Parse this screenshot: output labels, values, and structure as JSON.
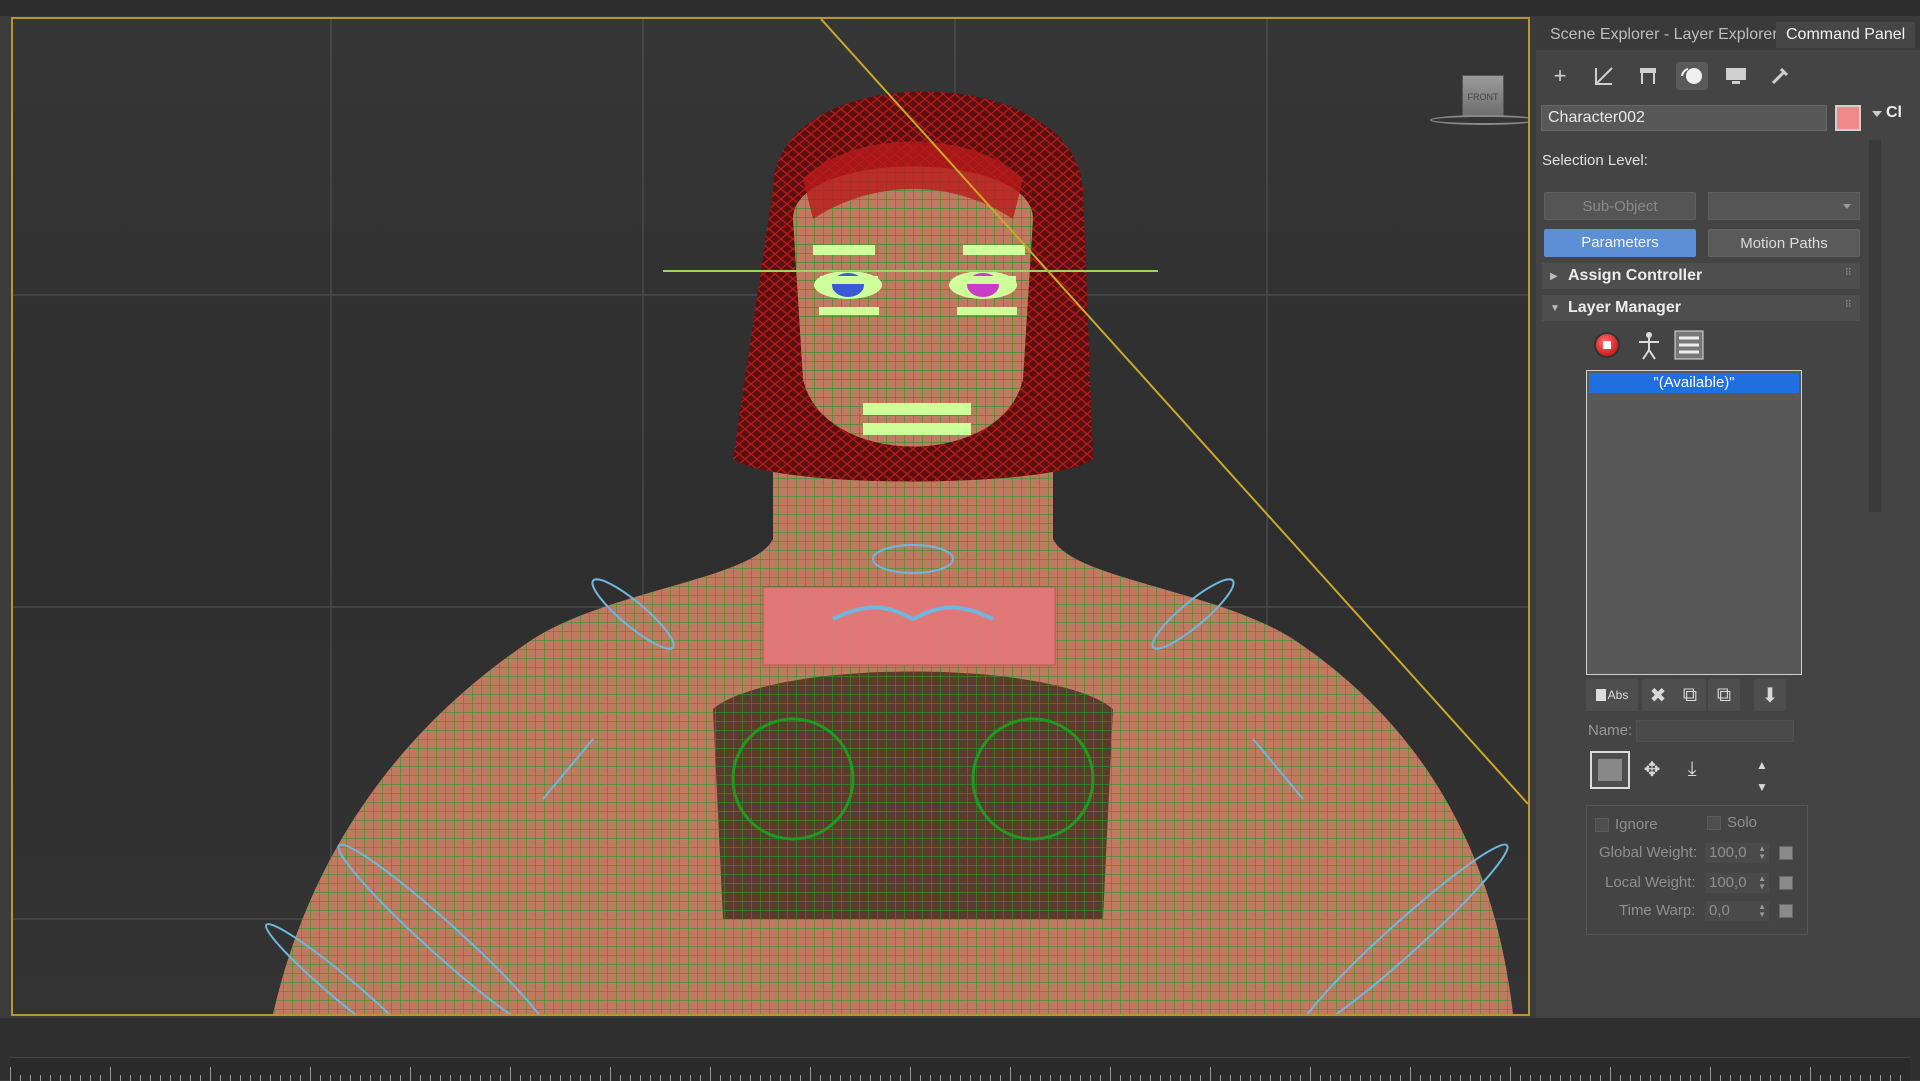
{
  "viewport": {
    "viewcube_label": "FRONT",
    "object_colors": {
      "wire_skin": "#1f9a1f",
      "hair": "#b81a1a",
      "skin": "#c07a62",
      "selection_box": "#e37878",
      "eye_left": "#3b5bd6",
      "eye_right": "#c83dc8",
      "controls": "#cfff9a",
      "helpers": "#6fb7de"
    }
  },
  "panel": {
    "tabs": [
      "Scene Explorer - Layer Explorer",
      "Command Panel"
    ],
    "toolbar_icons": [
      "create-icon",
      "modify-icon",
      "hierarchy-icon",
      "motion-icon",
      "display-icon",
      "utilities-icon"
    ],
    "object_name": "Character002",
    "object_color": "#f08a8a",
    "cut_label": "Cl",
    "selection_level_label": "Selection Level:",
    "sub_object_label": "Sub-Object",
    "parameters_label": "Parameters",
    "motion_paths_label": "Motion Paths",
    "rollouts": {
      "assign_controller": "Assign Controller",
      "layer_manager": "Layer Manager"
    },
    "layer_list": [
      "\"(Available)\""
    ],
    "abs_label": "Abs",
    "name_label": "Name:",
    "ignore_label": "Ignore",
    "solo_label": "Solo",
    "global_weight_label": "Global Weight:",
    "global_weight_value": "100,0",
    "local_weight_label": "Local Weight:",
    "local_weight_value": "100,0",
    "time_warp_label": "Time Warp:",
    "time_warp_value": "0,0"
  }
}
